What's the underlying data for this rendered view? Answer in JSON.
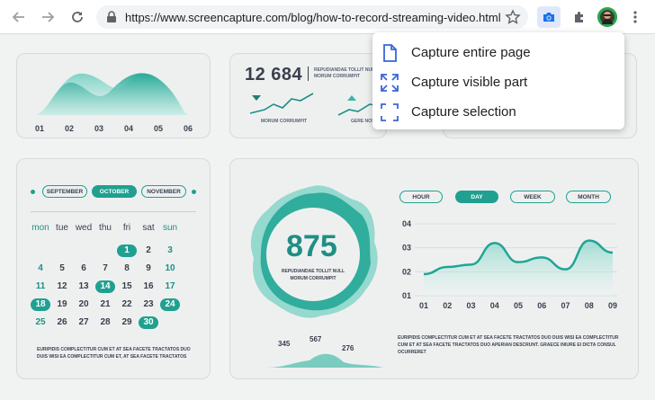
{
  "browser": {
    "url": "https://www.screencapture.com/blog/how-to-record-streaming-video.html",
    "icons": [
      "back-arrow-icon",
      "forward-arrow-icon",
      "reload-icon",
      "lock-icon",
      "bookmark-star-icon",
      "camera-extension-icon",
      "extensions-puzzle-icon",
      "profile-avatar",
      "more-menu-icon"
    ]
  },
  "capture_menu": {
    "items": [
      {
        "label": "Capture entire page",
        "icon": "page-icon"
      },
      {
        "label": "Capture visible part",
        "icon": "expand-corners-icon"
      },
      {
        "label": "Capture selection",
        "icon": "selection-corners-icon"
      }
    ]
  },
  "dashboard": {
    "area_card": {
      "ticks": [
        "01",
        "02",
        "03",
        "04",
        "05",
        "06"
      ]
    },
    "number_card": {
      "value": "12 684",
      "caption": "REPUDIANDAE TOLLIT NULL MORUM CORRUMPIT",
      "spark_label_1": "MORUM CORRUMPIT",
      "spark_label_2": "GERE NOS"
    },
    "calendar": {
      "months": [
        "SEPTEMBER",
        "OCTOBER",
        "NOVEMBER"
      ],
      "active_month": "OCTOBER",
      "weekdays": [
        "mon",
        "tue",
        "wed",
        "thu",
        "fri",
        "sat",
        "sun"
      ],
      "rows": [
        [
          "",
          "",
          "",
          "",
          "1",
          "2",
          "3"
        ],
        [
          "4",
          "5",
          "6",
          "7",
          "8",
          "9",
          "10"
        ],
        [
          "11",
          "12",
          "13",
          "14",
          "15",
          "16",
          "17"
        ],
        [
          "18",
          "19",
          "20",
          "21",
          "22",
          "23",
          "24"
        ],
        [
          "25",
          "26",
          "27",
          "28",
          "29",
          "30",
          ""
        ]
      ],
      "highlighted": [
        "1",
        "14",
        "18",
        "24",
        "30"
      ],
      "footer": "EURIPIDIS COMPLECTITUR CUM ET AT SEA FACETE TRACTATOS DUO DUIS WISI EA COMPLECTITUR CUM ET, AT SEA FACETE TRACTATOS"
    },
    "stats_card": {
      "big_value": "875",
      "big_caption": "REPUDIANDAE TOLLIT NULL MORUM CORRUMPIT",
      "mini_values": [
        "345",
        "567",
        "276"
      ],
      "ranges": [
        "HOUR",
        "DAY",
        "WEEK",
        "MONTH"
      ],
      "active_range": "DAY",
      "footer": "EURIPIDIS COMPLECTITUR CUM ET AT SEA FACETE TRACTATOS DUO DUIS WISI EA COMPLECTITUR CUM ET AT SEA FACETE TRACTATOS DUO APERIAN DESCRUNT. GRAECE INIURE EI DICTA CONSUL OCURRERET"
    },
    "colors": {
      "accent": "#20a090",
      "accent_light": "#a8e0d6",
      "text": "#3a3f4c"
    }
  },
  "chart_data": {
    "type": "line",
    "x": [
      "01",
      "02",
      "03",
      "04",
      "05",
      "06",
      "07",
      "08",
      "09"
    ],
    "y_ticks": [
      "01",
      "02",
      "03",
      "04"
    ],
    "ylim": [
      1,
      4
    ],
    "values": [
      1.9,
      2.2,
      2.3,
      3.2,
      2.4,
      2.6,
      2.1,
      3.3,
      2.8
    ],
    "title": "",
    "xlabel": "",
    "ylabel": ""
  }
}
